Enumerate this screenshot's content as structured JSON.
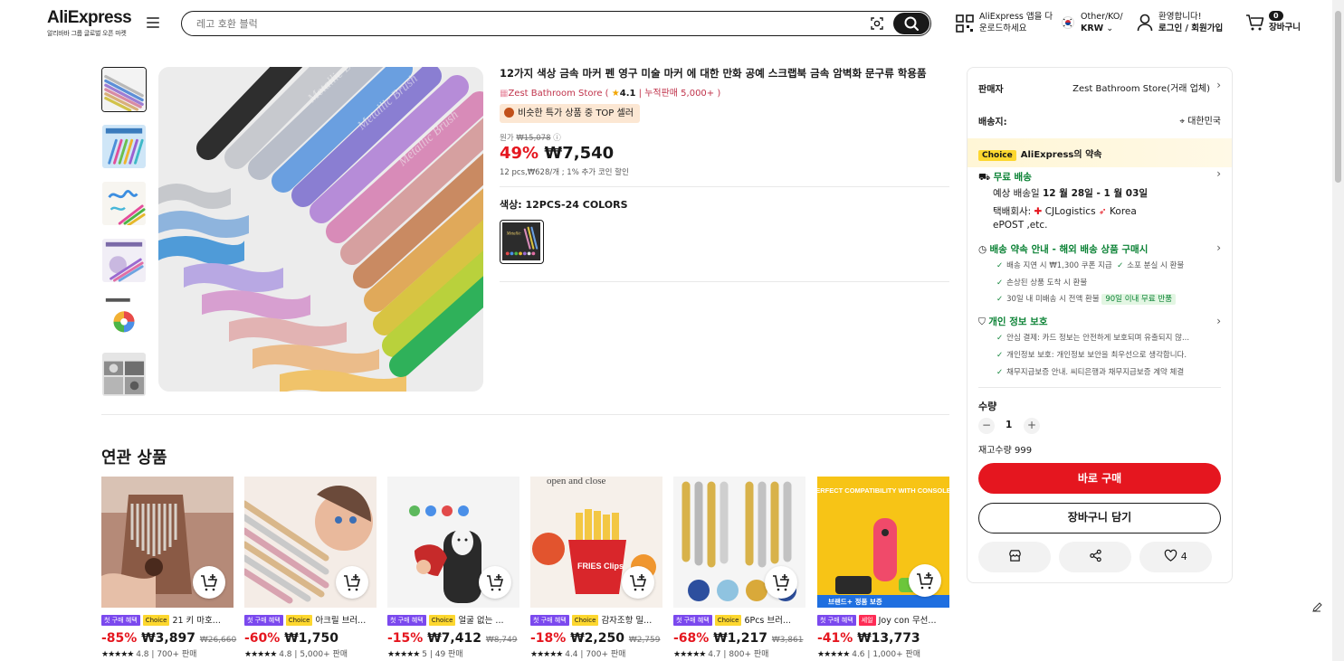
{
  "header": {
    "logo": "AliExpress",
    "logo_sub": "알리바바 그룹 글로벌 오픈 마켓",
    "search_placeholder": "레고 호환 블럭",
    "app_line1": "AliExpress 앱을 다",
    "app_line2": "운로드하세요",
    "region_line1": "Other/KO/",
    "region_line2": "KRW",
    "account_line1": "환영합니다!",
    "account_line2": "로그인 / 회원가입",
    "cart_count": "0",
    "cart_label": "장바구니"
  },
  "product": {
    "title": "12가지 색상 금속 마커 펜 영구 미술 마커 에 대한 만화 공예 스크랩북 금속 암벽화 문구류 학용품",
    "store": "Zest Bathroom Store",
    "rating": "4.1",
    "sold": "누적판매 5,000+",
    "top_seller": "비슷한 특가 상품 중 TOP 셀러",
    "orig_label": "원가",
    "orig_price": "₩15,078",
    "discount": "49%",
    "price": "₩7,540",
    "unit_info": "12 pcs,₩628/개 ; 1% 추가 코인 할인",
    "color_label": "색상: 12PCS-24 COLORS"
  },
  "related": {
    "title": "연관 상품",
    "items": [
      {
        "tag1": "첫 구매 혜택",
        "tag2": "Choice",
        "name": "21 키 마호...",
        "discount": "-85%",
        "price": "₩3,897",
        "orig": "₩26,660",
        "rating": "4.8",
        "sold": "700+ 판매"
      },
      {
        "tag1": "첫 구매 혜택",
        "tag2": "Choice",
        "name": "아크릴 브러...",
        "discount": "-60%",
        "price": "₩1,750",
        "orig": "",
        "rating": "4.8",
        "sold": "5,000+ 판매"
      },
      {
        "tag1": "첫 구매 혜택",
        "tag2": "Choice",
        "name": "얼굴 없는 ...",
        "discount": "-15%",
        "price": "₩7,412",
        "orig": "₩8,749",
        "rating": "5",
        "sold": "49 판매"
      },
      {
        "tag1": "첫 구매 혜택",
        "tag2": "Choice",
        "name": "감자조항 밀...",
        "discount": "-18%",
        "price": "₩2,250",
        "orig": "₩2,759",
        "rating": "4.4",
        "sold": "700+ 판매"
      },
      {
        "tag1": "첫 구매 혜택",
        "tag2": "Choice",
        "name": "6Pcs 브러...",
        "discount": "-68%",
        "price": "₩1,217",
        "orig": "₩3,861",
        "rating": "4.7",
        "sold": "800+ 판매"
      },
      {
        "tag1": "첫 구매 혜택",
        "tag2": "세일",
        "name": "Joy con 무선...",
        "discount": "-41%",
        "price": "₩13,773",
        "orig": "",
        "rating": "4.6",
        "sold": "1,000+ 판매"
      }
    ],
    "banner_text": "브랜드+ 정품 보증",
    "card1_text": "PERFECT COMPATIBILITY WITH CONSOLES",
    "card4_text": "open and close",
    "card4_logo": "FRIES Clips"
  },
  "panel": {
    "seller_label": "판매자",
    "seller_value": "Zest Bathroom Store(거래 업체)",
    "ship_label": "배송지:",
    "ship_value": "대한민국",
    "choice_tag": "Choice",
    "choice_text": "AliExpress의 약속",
    "free_ship": "무료 배송",
    "eta_prefix": "예상 배송일 ",
    "eta_value": "12 월 28일 - 1 월 03일",
    "carrier_label": "택배회사:",
    "carrier1": "CJLogistics",
    "carrier2": "Korea",
    "carrier3": "ePOST ,etc.",
    "promise_title": "배송 약속 안내 - 해외 배송 상품 구매시",
    "promise1": "배송 지연 시 ₩1,300 쿠폰 지급",
    "promise2": "소포 분실 시 환불",
    "promise3": "손상된 상품 도착 시 환불",
    "promise4": "30일 내 미배송 시 전액 환불",
    "promise4_badge": "90일 이내 무료 반품",
    "privacy_title": "개인 정보 보호",
    "privacy1": "안심 결제: 카드 정보는 안전하게 보호되며 유출되지 않...",
    "privacy2": "개인정보 보호: 개인정보 보안을 최우선으로 생각합니다.",
    "privacy3": "채무지급보증 안내. 씨티은행과 채무지급보증 계약 체결",
    "qty_label": "수량",
    "qty_value": "1",
    "stock": "재고수량 999",
    "buy_now": "바로 구매",
    "add_cart": "장바구니 담기",
    "wish_count": "4"
  }
}
